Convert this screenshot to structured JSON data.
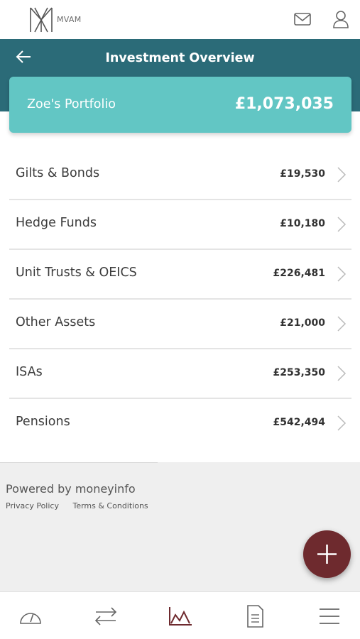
{
  "brand": {
    "logo_text": "MVAM"
  },
  "header": {
    "title": "Investment Overview"
  },
  "portfolio": {
    "name": "Zoe's Portfolio",
    "total": "£1,073,035"
  },
  "assets": [
    {
      "label": "Gilts & Bonds",
      "value": "£19,530"
    },
    {
      "label": "Hedge Funds",
      "value": "£10,180"
    },
    {
      "label": "Unit Trusts & OEICS",
      "value": "£226,481"
    },
    {
      "label": "Other Assets",
      "value": "£21,000"
    },
    {
      "label": "ISAs",
      "value": "£253,350"
    },
    {
      "label": "Pensions",
      "value": "£542,494"
    }
  ],
  "footer": {
    "powered_by": "Powered by moneyinfo",
    "privacy": "Privacy Policy",
    "terms": "Terms & Conditions"
  },
  "colors": {
    "header_bg": "#2b6b78",
    "card_bg": "#62c6c4",
    "fab_bg": "#6e2a2e",
    "footer_bg": "#efefef"
  },
  "nav": {
    "items": [
      "dashboard-icon",
      "transfer-icon",
      "chart-icon",
      "document-icon",
      "menu-icon"
    ],
    "active": "chart-icon"
  }
}
